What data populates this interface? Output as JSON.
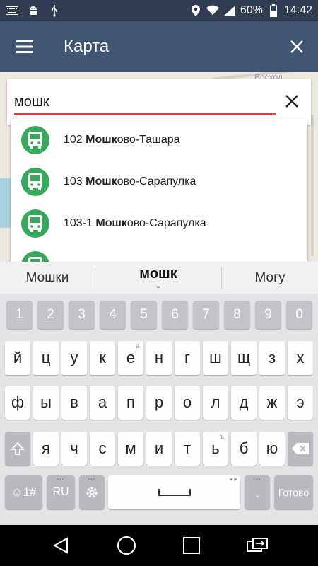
{
  "status_bar": {
    "battery": "60%",
    "time": "14:42",
    "icons": [
      "keyboard-icon",
      "android-icon",
      "usb-icon",
      "location-icon",
      "wifi-icon",
      "signal-icon",
      "battery-icon"
    ]
  },
  "app_bar": {
    "title": "Карта",
    "icons": [
      "menu-icon",
      "close-icon"
    ]
  },
  "search": {
    "value": "мошк",
    "clear_icon": "close-icon"
  },
  "map": {
    "label": "Восход"
  },
  "suggestions": [
    {
      "prefix": "102 ",
      "match": "Мошк",
      "suffix": "ово-Ташара"
    },
    {
      "prefix": "103 ",
      "match": "Мошк",
      "suffix": "ово-Сарапулка"
    },
    {
      "prefix": "103-1 ",
      "match": "Мошк",
      "suffix": "ово-Сарапулка"
    }
  ],
  "keyboard": {
    "predictions": [
      "Мошки",
      "мошк",
      "Могу"
    ],
    "number_row": [
      "1",
      "2",
      "3",
      "4",
      "5",
      "6",
      "7",
      "8",
      "9",
      "0"
    ],
    "row1": [
      "й",
      "ц",
      "у",
      "к",
      "е",
      "н",
      "г",
      "ш",
      "щ",
      "з",
      "х"
    ],
    "row2": [
      "ф",
      "ы",
      "в",
      "а",
      "п",
      "р",
      "о",
      "л",
      "д",
      "ж",
      "э"
    ],
    "row3": [
      "я",
      "ч",
      "с",
      "м",
      "и",
      "т",
      "ь",
      "б",
      "ю"
    ],
    "row1_hints": {
      "4": "ё"
    },
    "row3_hints": {
      "6": "ъ"
    },
    "emoji_label": "☺1#",
    "lang_label": "RU",
    "period_label": ".",
    "done_label": "Готово"
  },
  "colors": {
    "app_bar": "#3f5572",
    "status_bar": "#2f3c52",
    "bus_badge": "#3aa75f",
    "input_underline": "#e53935"
  }
}
